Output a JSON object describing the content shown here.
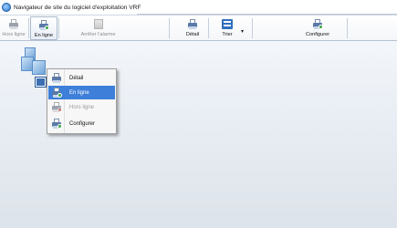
{
  "window": {
    "title": "Navigateur de site du logiciel d'exploitation VRF"
  },
  "toolbar": {
    "buttons": [
      {
        "label": "Hors ligne",
        "icon": "printer-offline-icon",
        "state": "disabled"
      },
      {
        "label": "En ligne",
        "icon": "printer-online-icon",
        "state": "pressed"
      },
      {
        "label": "Arrêter l'alarme",
        "icon": "alarm-stop-icon",
        "state": "disabled"
      },
      {
        "label": "Détail",
        "icon": "printer-detail-icon",
        "state": "normal"
      },
      {
        "label": "Trier",
        "icon": "sort-icon",
        "state": "normal"
      },
      {
        "label": "Configurer",
        "icon": "printer-configure-icon",
        "state": "normal"
      }
    ]
  },
  "context_menu": {
    "items": [
      {
        "label": "Détail",
        "state": "normal",
        "icon": "printer-icon"
      },
      {
        "label": "En ligne",
        "state": "selected",
        "icon": "printer-online-icon"
      },
      {
        "label": "Hors ligne",
        "state": "disabled",
        "icon": "printer-offline-icon"
      },
      {
        "label": "Configurer",
        "state": "normal",
        "icon": "configure-icon"
      }
    ]
  },
  "colors": {
    "selection": "#3d7fd9",
    "accent_blue": "#2e6fbf"
  }
}
